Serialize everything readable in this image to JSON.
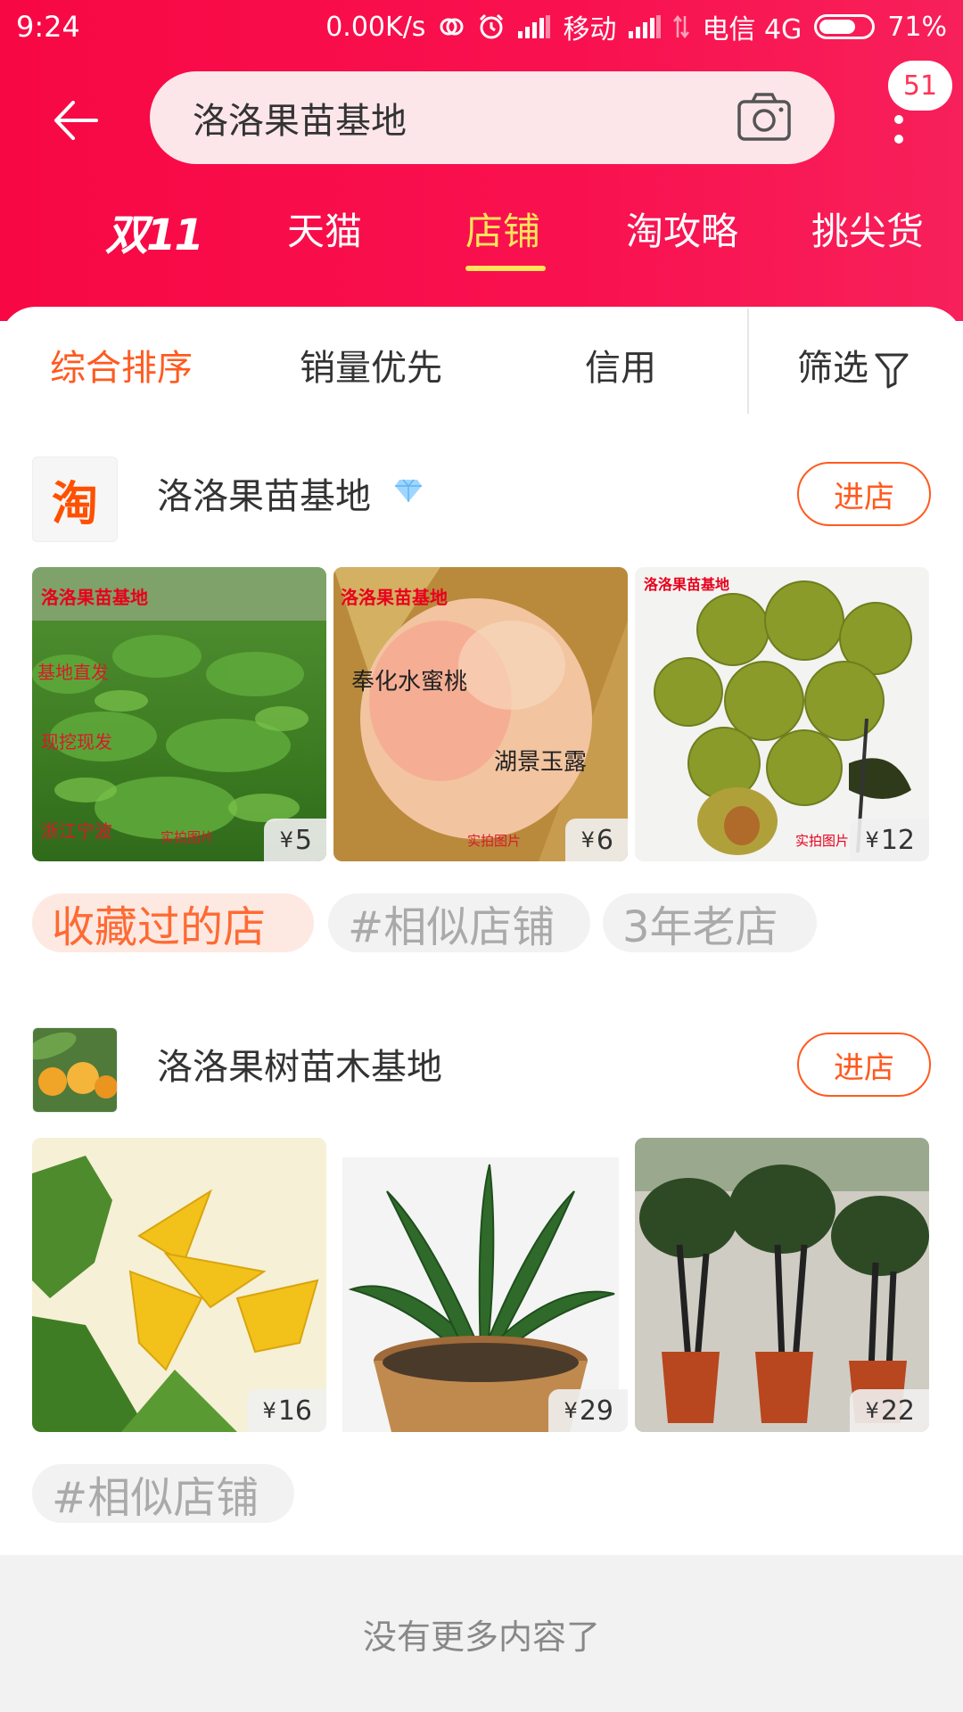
{
  "status": {
    "time": "9:24",
    "speed": "0.00K/s",
    "carrier1": "移动",
    "carrier2": "电信 4G",
    "battery_pct": 0.71,
    "battery": "71%"
  },
  "search": {
    "query": "洛洛果苗基地"
  },
  "badge": "51",
  "tabs": {
    "logo": "双11",
    "items": [
      "天猫",
      "店铺",
      "淘攻略",
      "挑尖货"
    ],
    "active": "店铺"
  },
  "sort": {
    "items": [
      "综合排序",
      "销量优先",
      "信用"
    ],
    "filter": "筛选"
  },
  "shops": [
    {
      "name": "洛洛果苗基地",
      "logo_text": "淘",
      "enter": "进店",
      "products": [
        {
          "price": "5",
          "image_texts": [
            "洛洛果苗基地",
            "基地直发",
            "现挖现发",
            "浙江宁波",
            "实拍图片"
          ]
        },
        {
          "price": "6",
          "image_texts": [
            "洛洛果苗基地",
            "奉化水蜜桃",
            "湖景玉露",
            "实拍图片"
          ]
        },
        {
          "price": "12",
          "image_texts": [
            "洛洛果苗基地",
            "实拍图片"
          ]
        }
      ],
      "tags": [
        "收藏过的店",
        "#相似店铺",
        "3年老店"
      ]
    },
    {
      "name": "洛洛果树苗木基地",
      "enter": "进店",
      "products": [
        {
          "price": "16"
        },
        {
          "price": "29"
        },
        {
          "price": "22"
        }
      ],
      "tags": [
        "#相似店铺"
      ]
    }
  ],
  "currency": "¥",
  "footer": "没有更多内容了",
  "colors": {
    "brand_red": "#f70844",
    "accent_orange": "#ff5a1f",
    "tab_active": "#ffe45c"
  }
}
